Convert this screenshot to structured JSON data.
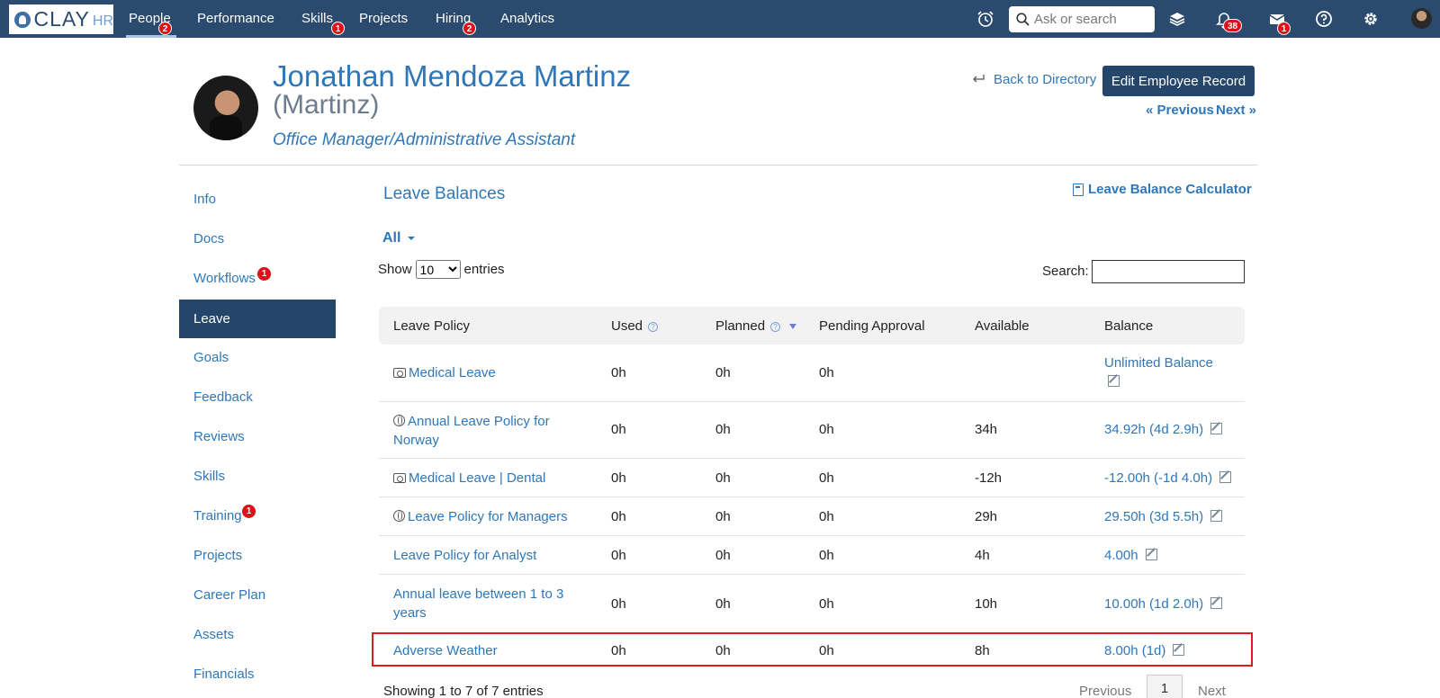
{
  "app": {
    "logo_text": "CLAY",
    "logo_suffix": "HR"
  },
  "nav": {
    "items": [
      {
        "label": "People",
        "badge": "2"
      },
      {
        "label": "Performance",
        "badge": ""
      },
      {
        "label": "Skills",
        "badge": "1"
      },
      {
        "label": "Projects",
        "badge": ""
      },
      {
        "label": "Hiring",
        "badge": "2"
      },
      {
        "label": "Analytics",
        "badge": ""
      }
    ],
    "search_placeholder": "Ask or search",
    "notifications_badge": "38",
    "mail_badge": "1",
    "icons": [
      "alarm-clock-icon",
      "layers-icon",
      "bell-icon",
      "mail-icon",
      "help-icon",
      "gear-icon",
      "user-avatar"
    ]
  },
  "employee": {
    "name": "Jonathan Mendoza Martinz",
    "nickname": "(Martinz)",
    "title": "Office Manager/Administrative Assistant"
  },
  "header_actions": {
    "back": "Back to Directory",
    "edit": "Edit Employee Record",
    "previous": "« Previous",
    "next": "Next »"
  },
  "sidebar": {
    "items": [
      {
        "label": "Info",
        "badge": ""
      },
      {
        "label": "Docs",
        "badge": ""
      },
      {
        "label": "Workflows",
        "badge": "1"
      },
      {
        "label": "Leave",
        "badge": "",
        "active": true
      },
      {
        "label": "Goals",
        "badge": ""
      },
      {
        "label": "Feedback",
        "badge": ""
      },
      {
        "label": "Reviews",
        "badge": ""
      },
      {
        "label": "Skills",
        "badge": ""
      },
      {
        "label": "Training",
        "badge": "1"
      },
      {
        "label": "Projects",
        "badge": ""
      },
      {
        "label": "Career Plan",
        "badge": ""
      },
      {
        "label": "Assets",
        "badge": ""
      },
      {
        "label": "Financials",
        "badge": ""
      }
    ]
  },
  "leave": {
    "section_title": "Leave Balances",
    "calculator_link": "Leave Balance Calculator",
    "filter": "All",
    "show_label": "Show",
    "entries_label": "entries",
    "page_size": "10",
    "search_label": "Search:",
    "columns": [
      "Leave Policy",
      "Used",
      "Planned",
      "Pending Approval",
      "Available",
      "Balance"
    ],
    "rows": [
      {
        "policy": "Medical Leave",
        "icon": "camera-icon",
        "used": "0h",
        "planned": "0h",
        "pending": "0h",
        "available": "",
        "balance": "Unlimited Balance"
      },
      {
        "policy": "Annual Leave Policy for Norway",
        "icon": "globe-icon",
        "used": "0h",
        "planned": "0h",
        "pending": "0h",
        "available": "34h",
        "balance": "34.92h (4d 2.9h)"
      },
      {
        "policy": "Medical Leave | Dental",
        "icon": "camera-icon",
        "used": "0h",
        "planned": "0h",
        "pending": "0h",
        "available": "-12h",
        "balance": "-12.00h (-1d 4.0h)"
      },
      {
        "policy": "Leave Policy for Managers",
        "icon": "globe-icon",
        "used": "0h",
        "planned": "0h",
        "pending": "0h",
        "available": "29h",
        "balance": "29.50h (3d 5.5h)"
      },
      {
        "policy": "Leave Policy for Analyst",
        "icon": "",
        "used": "0h",
        "planned": "0h",
        "pending": "0h",
        "available": "4h",
        "balance": "4.00h"
      },
      {
        "policy": "Annual leave between 1 to 3 years",
        "icon": "",
        "used": "0h",
        "planned": "0h",
        "pending": "0h",
        "available": "10h",
        "balance": "10.00h (1d 2.0h)"
      },
      {
        "policy": "Adverse Weather",
        "icon": "",
        "used": "0h",
        "planned": "0h",
        "pending": "0h",
        "available": "8h",
        "balance": "8.00h (1d)"
      }
    ],
    "footer_info": "Showing 1 to 7 of 7 entries",
    "pagination": {
      "previous": "Previous",
      "current": "1",
      "next": "Next"
    }
  },
  "colors": {
    "nav_bg": "#2a4a6e",
    "link": "#2f77b8",
    "active_bg": "#24466b",
    "badge": "#e0101a",
    "highlight": "#e11b1b"
  }
}
